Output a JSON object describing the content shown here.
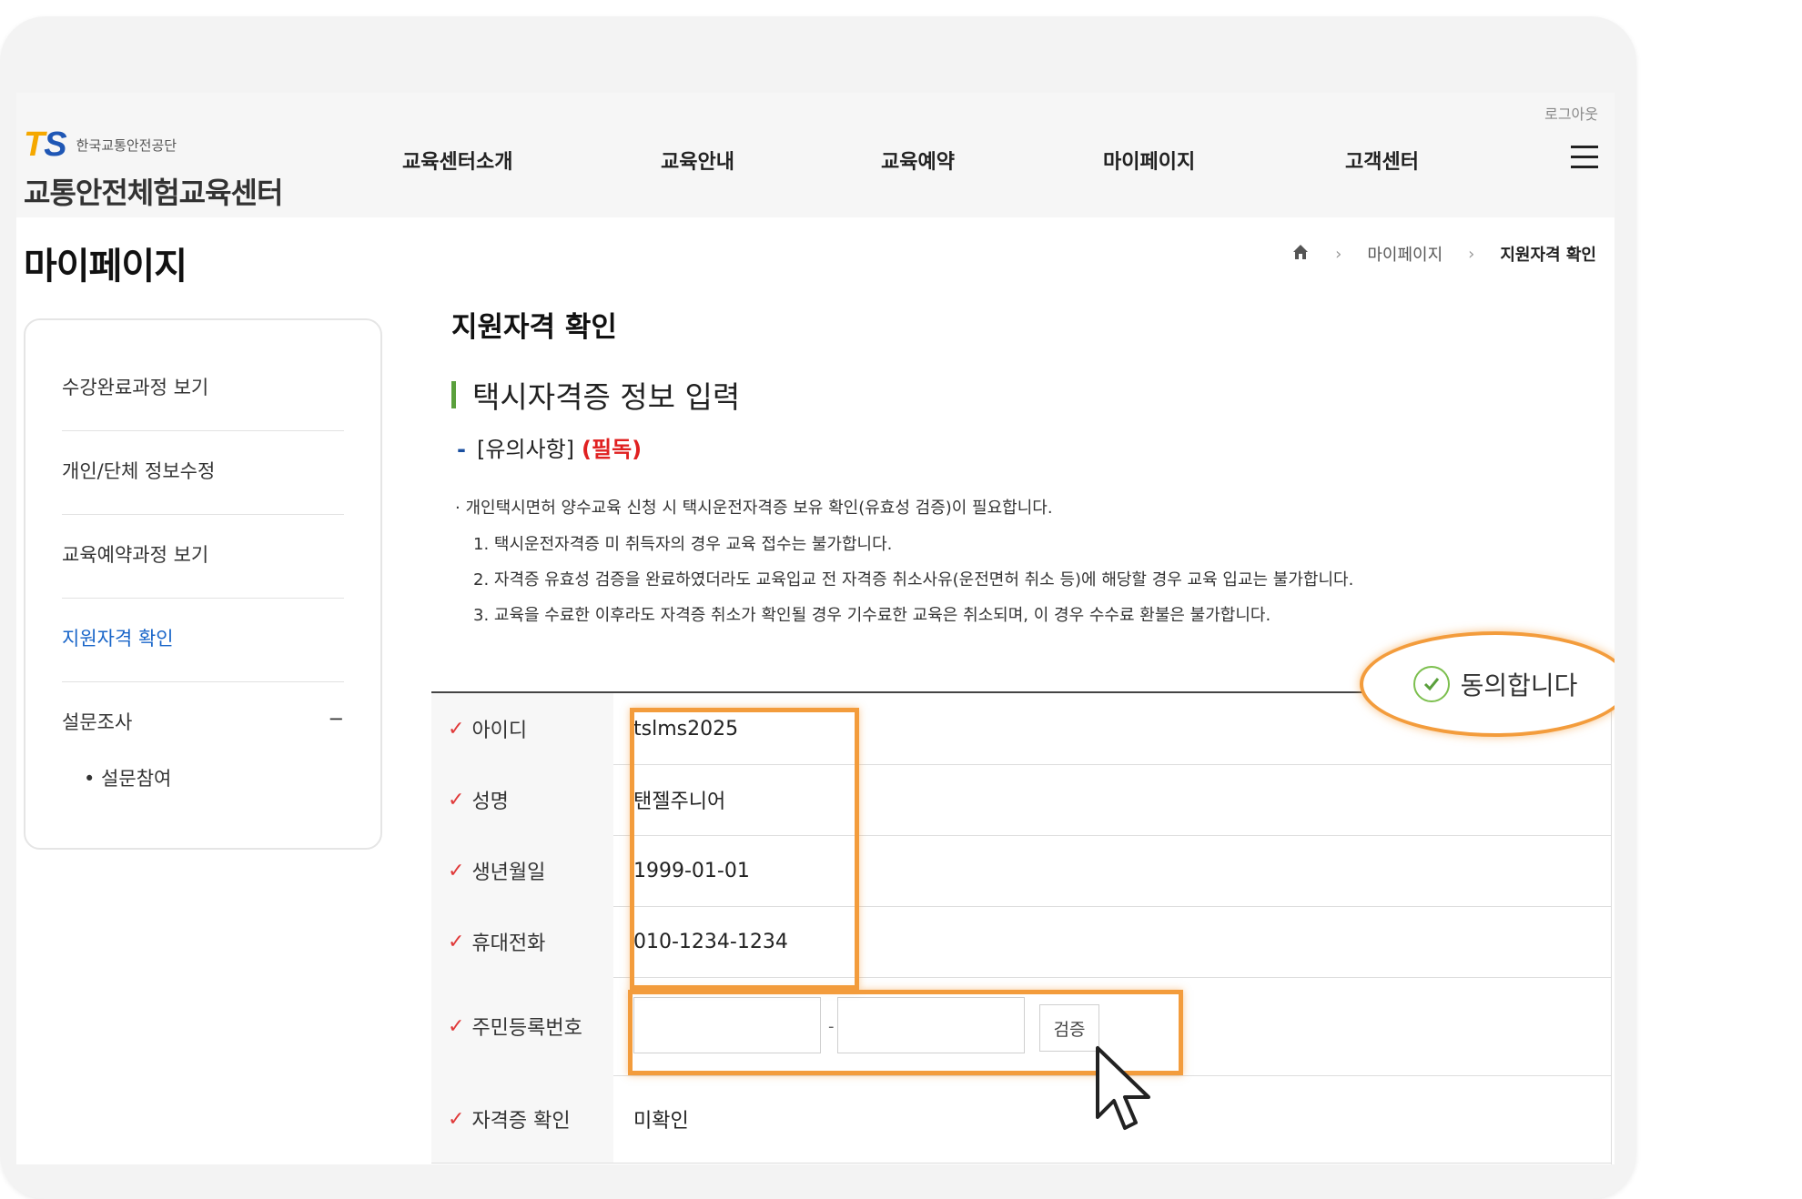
{
  "header": {
    "logo_mark_t": "T",
    "logo_mark_s": "S",
    "logo_org": "한국교통안전공단",
    "logo_name": "교통안전체험교육센터",
    "nav": [
      "교육센터소개",
      "교육안내",
      "교육예약",
      "마이페이지",
      "고객센터"
    ],
    "logout": "로그아웃"
  },
  "page_title": "마이페이지",
  "breadcrumb": {
    "sep": "›",
    "items": [
      "마이페이지",
      "지원자격 확인"
    ]
  },
  "sidebar": {
    "items": [
      "수강완료과정 보기",
      "개인/단체 정보수정",
      "교육예약과정 보기",
      "지원자격 확인",
      "설문조사"
    ],
    "toggle": "−",
    "sub_item": "• 설문참여"
  },
  "main": {
    "title": "지원자격 확인",
    "subtitle": "택시자격증 정보 입력",
    "notice_dash": "-",
    "notice_head": "[유의사항]",
    "notice_required": "(필독)",
    "notice_lines": [
      "· 개인택시면허 양수교육 신청 시 택시운전자격증 보유 확인(유효성 검증)이 필요합니다.",
      "1. 택시운전자격증 미 취득자의 경우 교육 접수는 불가합니다.",
      "2. 자격증 유효성 검증을 완료하였더라도 교육입교 전 자격증 취소사유(운전면허 취소 등)에 해당할 경우 교육 입교는 불가합니다.",
      "3. 교육을 수료한 이후라도 자격증 취소가 확인될 경우 기수료한 교육은 취소되며, 이 경우 수수료 환불은 불가합니다."
    ],
    "agree_label": "동의합니다"
  },
  "form": {
    "check_mark": "✓",
    "rows": [
      {
        "label": "아이디",
        "value": "tslms2025"
      },
      {
        "label": "성명",
        "value": "탠젤주니어"
      },
      {
        "label": "생년월일",
        "value": "1999-01-01"
      },
      {
        "label": "휴대전화",
        "value": "010-1234-1234"
      },
      {
        "label": "주민등록번호",
        "value": ""
      },
      {
        "label": "자격증 확인",
        "value": "미확인"
      }
    ],
    "ssn_dash": "-",
    "verify_label": "검증"
  },
  "colors": {
    "accent_green": "#5aa03c",
    "active_blue": "#1a66c9",
    "highlight_orange": "#f39c3c",
    "required_red": "#e02020"
  }
}
